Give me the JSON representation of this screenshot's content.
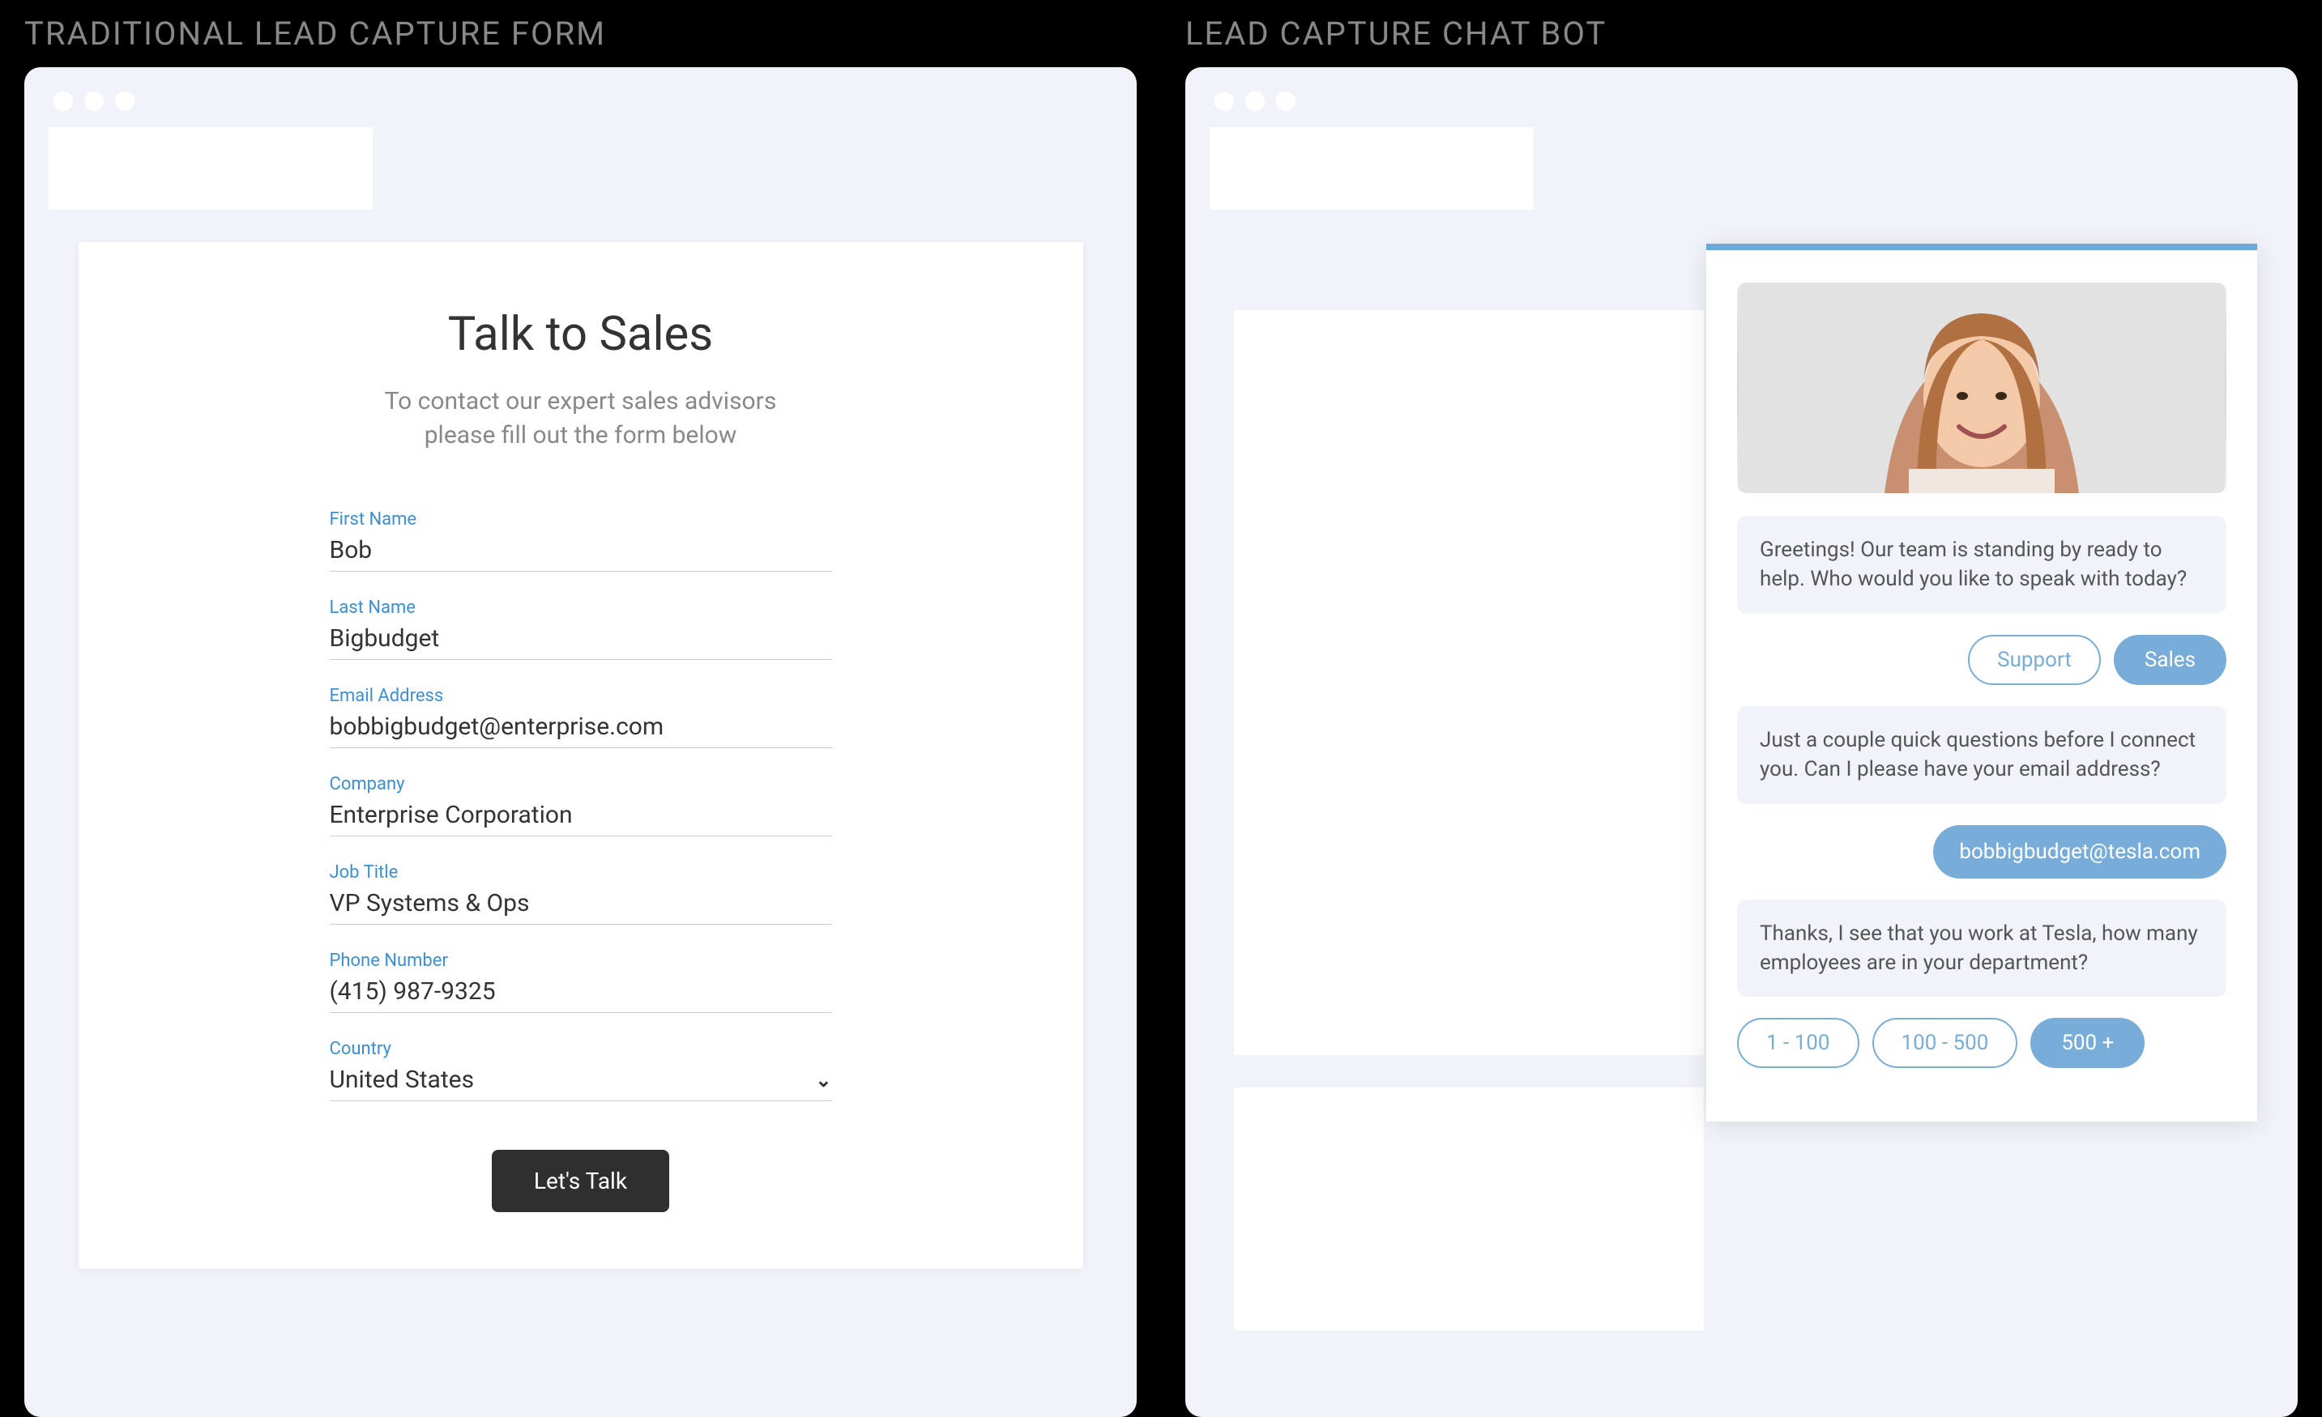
{
  "left": {
    "panel_title": "TRADITIONAL LEAD CAPTURE FORM",
    "form": {
      "title": "Talk to Sales",
      "subtitle_line1": "To contact our expert sales advisors",
      "subtitle_line2": "please fill out the form below",
      "fields": {
        "first_name": {
          "label": "First Name",
          "value": "Bob"
        },
        "last_name": {
          "label": "Last Name",
          "value": "Bigbudget"
        },
        "email": {
          "label": "Email Address",
          "value": "bobbigbudget@enterprise.com"
        },
        "company": {
          "label": "Company",
          "value": "Enterprise Corporation"
        },
        "job_title": {
          "label": "Job Title",
          "value": "VP Systems & Ops"
        },
        "phone": {
          "label": "Phone Number",
          "value": "(415) 987-9325"
        },
        "country": {
          "label": "Country",
          "value": "United States"
        }
      },
      "submit_label": "Let's Talk"
    }
  },
  "right": {
    "panel_title": "LEAD CAPTURE CHAT BOT",
    "chat": {
      "messages": {
        "greeting": "Greetings!  Our team is standing by ready to help.  Who would you like to speak with today?",
        "intent_options": {
          "support": "Support",
          "sales": "Sales"
        },
        "ask_email": "Just a couple quick questions before I connect you.  Can I please have your email address?",
        "user_email": "bobbigbudget@tesla.com",
        "ask_headcount": "Thanks, I see that you work at Tesla, how many employees are in your department?",
        "headcount_options": {
          "a": "1 - 100",
          "b": "100 - 500",
          "c": "500 +"
        }
      }
    }
  }
}
